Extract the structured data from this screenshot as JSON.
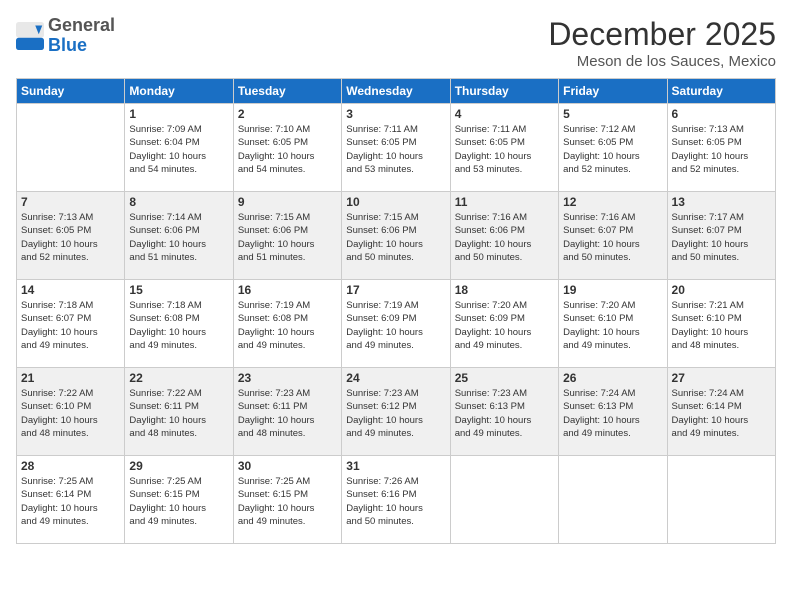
{
  "header": {
    "logo_general": "General",
    "logo_blue": "Blue",
    "title": "December 2025",
    "location": "Meson de los Sauces, Mexico"
  },
  "weekdays": [
    "Sunday",
    "Monday",
    "Tuesday",
    "Wednesday",
    "Thursday",
    "Friday",
    "Saturday"
  ],
  "weeks": [
    [
      {
        "day": "",
        "info": ""
      },
      {
        "day": "1",
        "info": "Sunrise: 7:09 AM\nSunset: 6:04 PM\nDaylight: 10 hours\nand 54 minutes."
      },
      {
        "day": "2",
        "info": "Sunrise: 7:10 AM\nSunset: 6:05 PM\nDaylight: 10 hours\nand 54 minutes."
      },
      {
        "day": "3",
        "info": "Sunrise: 7:11 AM\nSunset: 6:05 PM\nDaylight: 10 hours\nand 53 minutes."
      },
      {
        "day": "4",
        "info": "Sunrise: 7:11 AM\nSunset: 6:05 PM\nDaylight: 10 hours\nand 53 minutes."
      },
      {
        "day": "5",
        "info": "Sunrise: 7:12 AM\nSunset: 6:05 PM\nDaylight: 10 hours\nand 52 minutes."
      },
      {
        "day": "6",
        "info": "Sunrise: 7:13 AM\nSunset: 6:05 PM\nDaylight: 10 hours\nand 52 minutes."
      }
    ],
    [
      {
        "day": "7",
        "info": "Sunrise: 7:13 AM\nSunset: 6:05 PM\nDaylight: 10 hours\nand 52 minutes."
      },
      {
        "day": "8",
        "info": "Sunrise: 7:14 AM\nSunset: 6:06 PM\nDaylight: 10 hours\nand 51 minutes."
      },
      {
        "day": "9",
        "info": "Sunrise: 7:15 AM\nSunset: 6:06 PM\nDaylight: 10 hours\nand 51 minutes."
      },
      {
        "day": "10",
        "info": "Sunrise: 7:15 AM\nSunset: 6:06 PM\nDaylight: 10 hours\nand 50 minutes."
      },
      {
        "day": "11",
        "info": "Sunrise: 7:16 AM\nSunset: 6:06 PM\nDaylight: 10 hours\nand 50 minutes."
      },
      {
        "day": "12",
        "info": "Sunrise: 7:16 AM\nSunset: 6:07 PM\nDaylight: 10 hours\nand 50 minutes."
      },
      {
        "day": "13",
        "info": "Sunrise: 7:17 AM\nSunset: 6:07 PM\nDaylight: 10 hours\nand 50 minutes."
      }
    ],
    [
      {
        "day": "14",
        "info": "Sunrise: 7:18 AM\nSunset: 6:07 PM\nDaylight: 10 hours\nand 49 minutes."
      },
      {
        "day": "15",
        "info": "Sunrise: 7:18 AM\nSunset: 6:08 PM\nDaylight: 10 hours\nand 49 minutes."
      },
      {
        "day": "16",
        "info": "Sunrise: 7:19 AM\nSunset: 6:08 PM\nDaylight: 10 hours\nand 49 minutes."
      },
      {
        "day": "17",
        "info": "Sunrise: 7:19 AM\nSunset: 6:09 PM\nDaylight: 10 hours\nand 49 minutes."
      },
      {
        "day": "18",
        "info": "Sunrise: 7:20 AM\nSunset: 6:09 PM\nDaylight: 10 hours\nand 49 minutes."
      },
      {
        "day": "19",
        "info": "Sunrise: 7:20 AM\nSunset: 6:10 PM\nDaylight: 10 hours\nand 49 minutes."
      },
      {
        "day": "20",
        "info": "Sunrise: 7:21 AM\nSunset: 6:10 PM\nDaylight: 10 hours\nand 48 minutes."
      }
    ],
    [
      {
        "day": "21",
        "info": "Sunrise: 7:22 AM\nSunset: 6:10 PM\nDaylight: 10 hours\nand 48 minutes."
      },
      {
        "day": "22",
        "info": "Sunrise: 7:22 AM\nSunset: 6:11 PM\nDaylight: 10 hours\nand 48 minutes."
      },
      {
        "day": "23",
        "info": "Sunrise: 7:23 AM\nSunset: 6:11 PM\nDaylight: 10 hours\nand 48 minutes."
      },
      {
        "day": "24",
        "info": "Sunrise: 7:23 AM\nSunset: 6:12 PM\nDaylight: 10 hours\nand 49 minutes."
      },
      {
        "day": "25",
        "info": "Sunrise: 7:23 AM\nSunset: 6:13 PM\nDaylight: 10 hours\nand 49 minutes."
      },
      {
        "day": "26",
        "info": "Sunrise: 7:24 AM\nSunset: 6:13 PM\nDaylight: 10 hours\nand 49 minutes."
      },
      {
        "day": "27",
        "info": "Sunrise: 7:24 AM\nSunset: 6:14 PM\nDaylight: 10 hours\nand 49 minutes."
      }
    ],
    [
      {
        "day": "28",
        "info": "Sunrise: 7:25 AM\nSunset: 6:14 PM\nDaylight: 10 hours\nand 49 minutes."
      },
      {
        "day": "29",
        "info": "Sunrise: 7:25 AM\nSunset: 6:15 PM\nDaylight: 10 hours\nand 49 minutes."
      },
      {
        "day": "30",
        "info": "Sunrise: 7:25 AM\nSunset: 6:15 PM\nDaylight: 10 hours\nand 49 minutes."
      },
      {
        "day": "31",
        "info": "Sunrise: 7:26 AM\nSunset: 6:16 PM\nDaylight: 10 hours\nand 50 minutes."
      },
      {
        "day": "",
        "info": ""
      },
      {
        "day": "",
        "info": ""
      },
      {
        "day": "",
        "info": ""
      }
    ]
  ]
}
